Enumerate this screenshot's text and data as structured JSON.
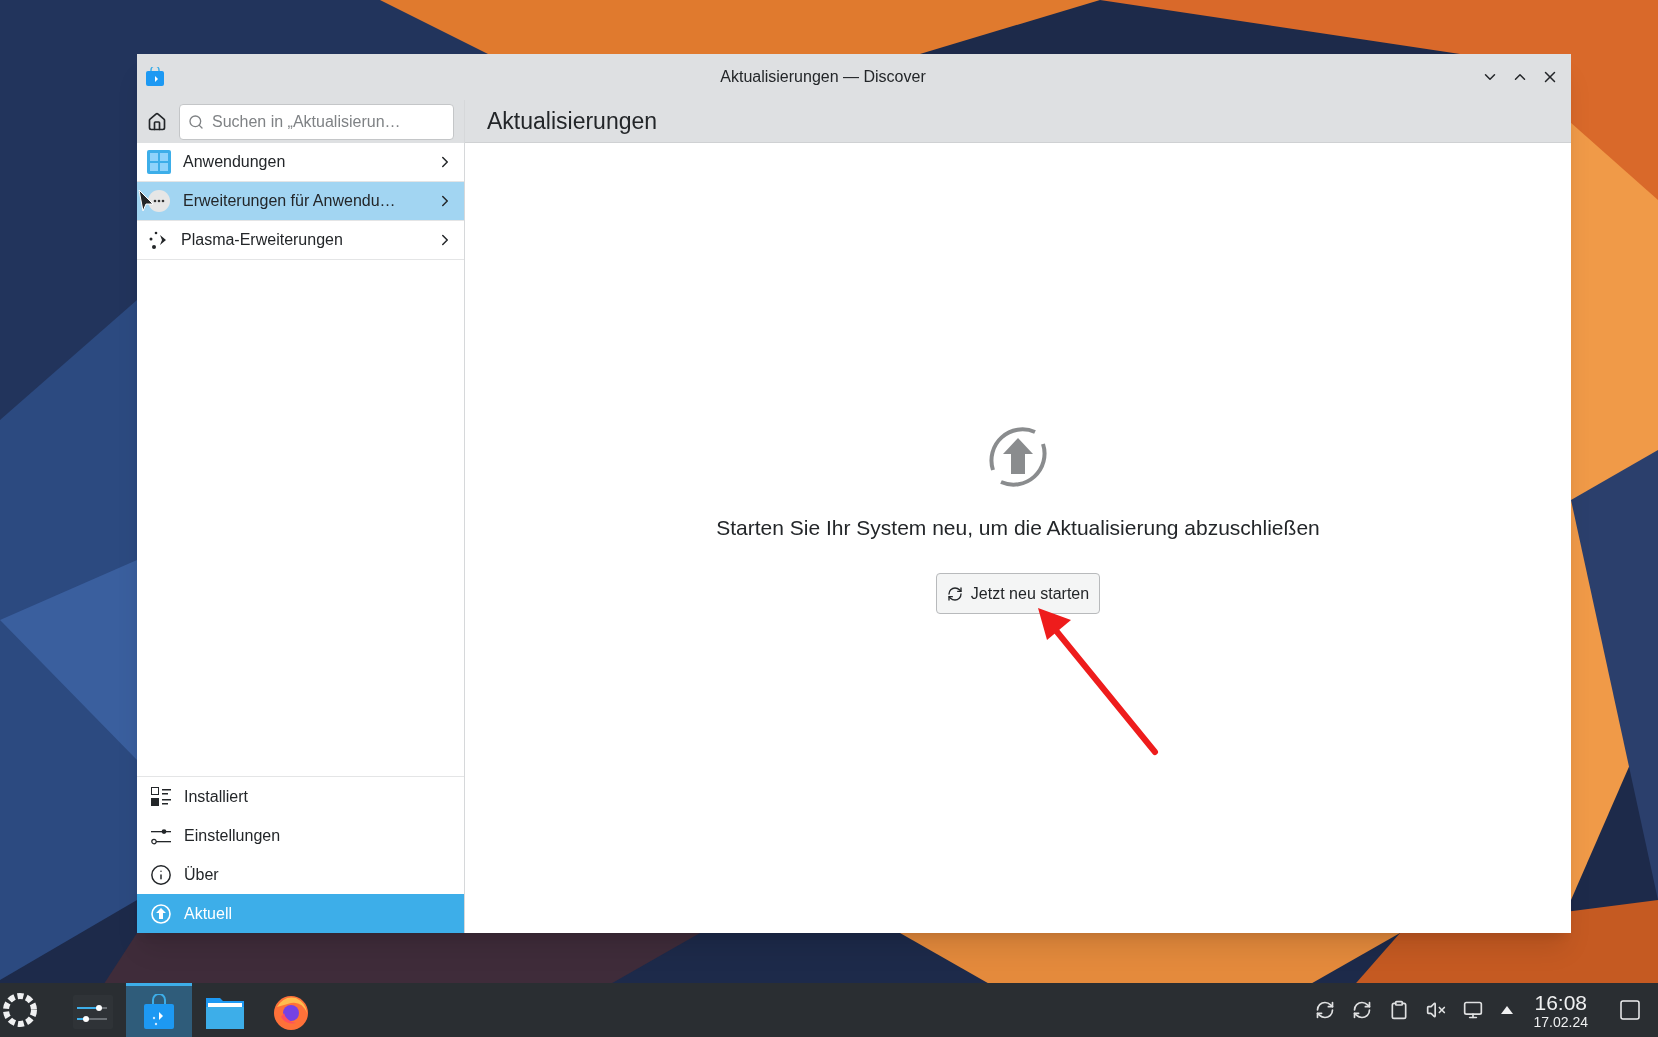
{
  "window": {
    "title": "Aktualisierungen — Discover"
  },
  "search": {
    "placeholder": "Suchen in „Aktualisierun…"
  },
  "page_title": "Aktualisierungen",
  "categories": [
    {
      "kind": "apps",
      "label": "Anwendungen",
      "selected": false
    },
    {
      "kind": "addons",
      "label": "Erweiterungen für Anwendu…",
      "selected": true
    },
    {
      "kind": "plasma",
      "label": "Plasma-Erweiterungen",
      "selected": false
    }
  ],
  "nav": [
    {
      "kind": "installed",
      "label": "Installiert",
      "selected": false
    },
    {
      "kind": "settings",
      "label": "Einstellungen",
      "selected": false
    },
    {
      "kind": "about",
      "label": "Über",
      "selected": false
    },
    {
      "kind": "updates",
      "label": "Aktuell",
      "selected": true
    }
  ],
  "message": "Starten Sie Ihr System neu, um die Aktualisierung abzuschließen",
  "restart_button": "Jetzt neu starten",
  "taskbar": {
    "apps": [
      {
        "kind": "settings",
        "selected": false
      },
      {
        "kind": "discover",
        "selected": true
      },
      {
        "kind": "files",
        "selected": false
      },
      {
        "kind": "firefox",
        "selected": false
      }
    ],
    "clock": {
      "time": "16:08",
      "date": "17.02.24"
    }
  }
}
